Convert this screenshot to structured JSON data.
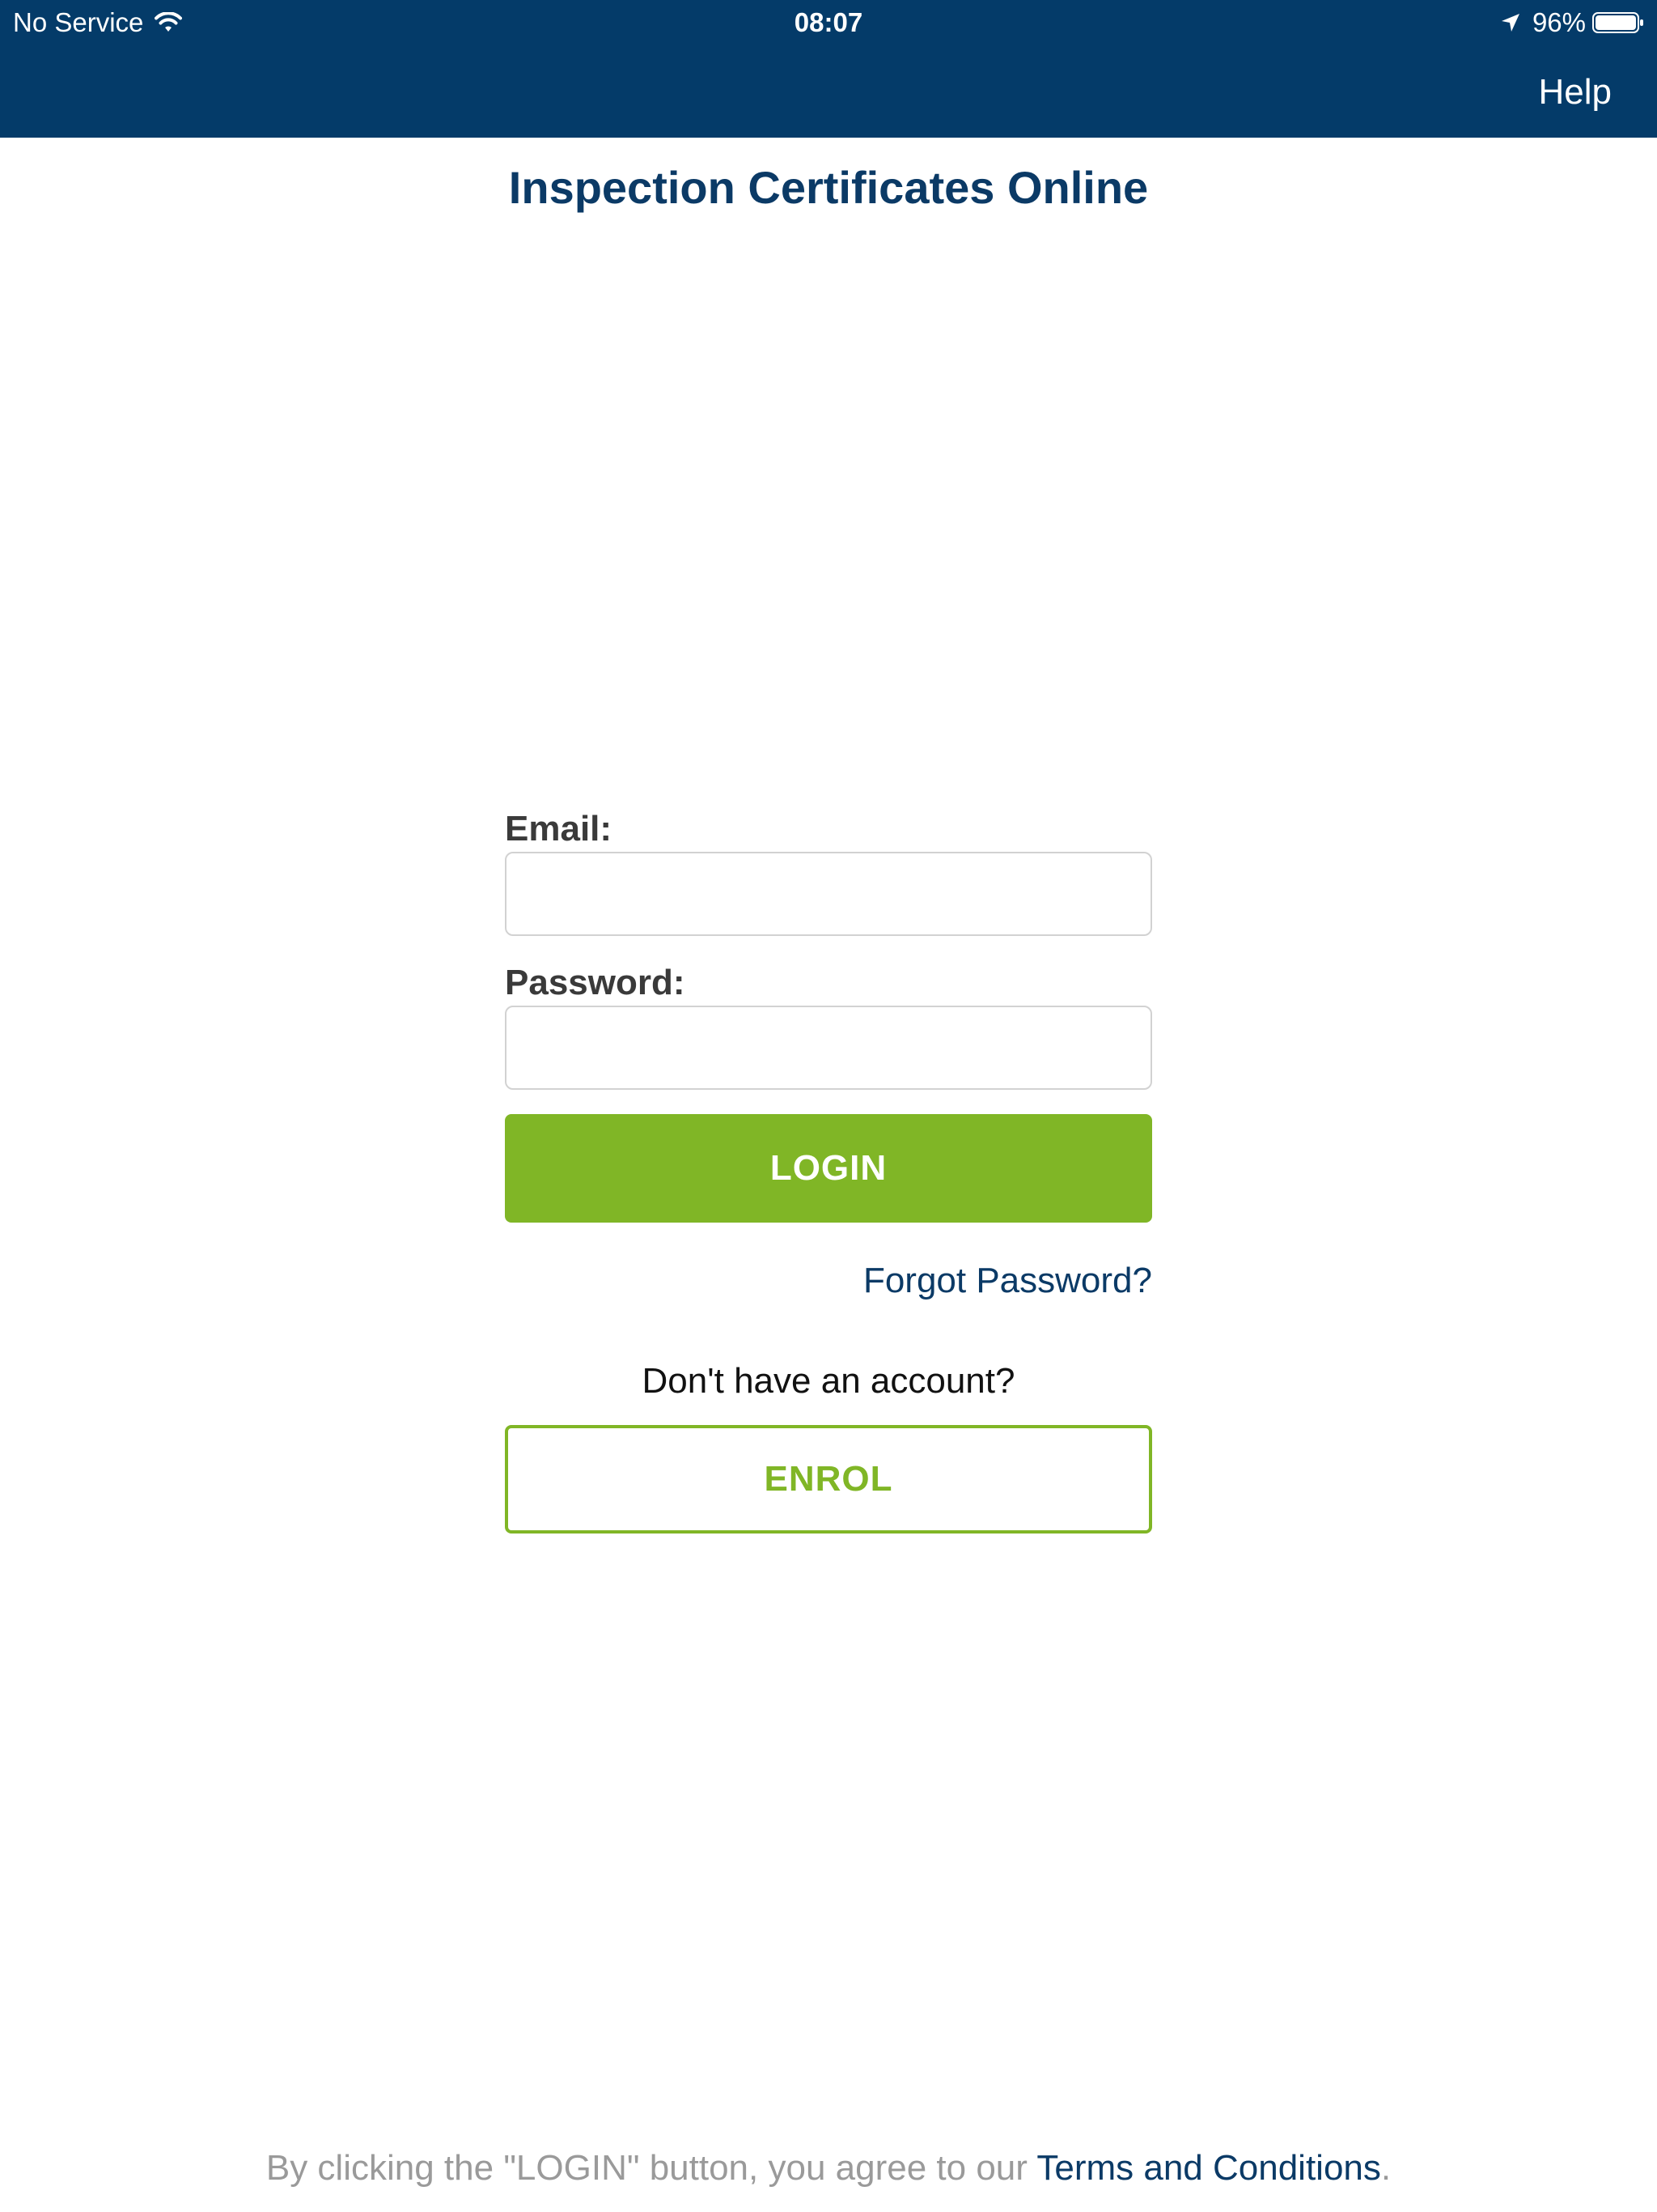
{
  "status_bar": {
    "carrier": "No Service",
    "time": "08:07",
    "battery": "96%"
  },
  "nav": {
    "help_label": "Help"
  },
  "page": {
    "title": "Inspection Certificates Online"
  },
  "login_form": {
    "email_label": "Email:",
    "email_value": "",
    "password_label": "Password:",
    "password_value": "",
    "login_label": "LOGIN",
    "forgot_label": "Forgot Password?",
    "no_account_text": "Don't have an account?",
    "enrol_label": "ENROL"
  },
  "footer": {
    "prefix": "By clicking the \"LOGIN\" button, you agree to our ",
    "terms_link": "Terms and Conditions",
    "suffix": "."
  },
  "colors": {
    "nav_background": "#043b69",
    "title_color": "#0b3a66",
    "accent_green": "#80b626",
    "link_blue": "#0b3a66"
  },
  "icons": [
    "wifi-icon",
    "location-arrow-icon",
    "battery-icon"
  ]
}
